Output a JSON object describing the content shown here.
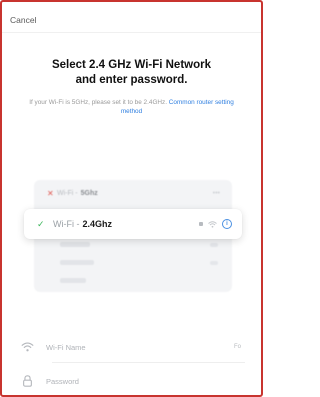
{
  "header": {
    "cancel_label": "Cancel"
  },
  "title": {
    "line1": "Select 2.4 GHz Wi-Fi Network",
    "line2": "and enter password."
  },
  "hint": {
    "text": "If your Wi-Fi is 5GHz, please set it to be 2.4GHz.",
    "link": "Common router setting method"
  },
  "networks": {
    "blocked": {
      "prefix": "Wi-Fi -",
      "band": "5Ghz"
    },
    "selected": {
      "prefix": "Wi-Fi -",
      "band": "2.4Ghz"
    }
  },
  "form": {
    "wifi_name_placeholder": "Wi-Fi Name",
    "wifi_name_trailing": "Fo",
    "password_placeholder": "Password"
  },
  "colors": {
    "frame_border": "#c8342f",
    "link": "#2f7fe0",
    "check": "#3bb55a",
    "cross": "#e0574f",
    "info": "#4a90e2"
  },
  "icons": [
    "cross-icon",
    "check-icon",
    "lock-icon",
    "wifi-signal-icon",
    "info-icon",
    "wifi-icon",
    "lock-field-icon"
  ]
}
